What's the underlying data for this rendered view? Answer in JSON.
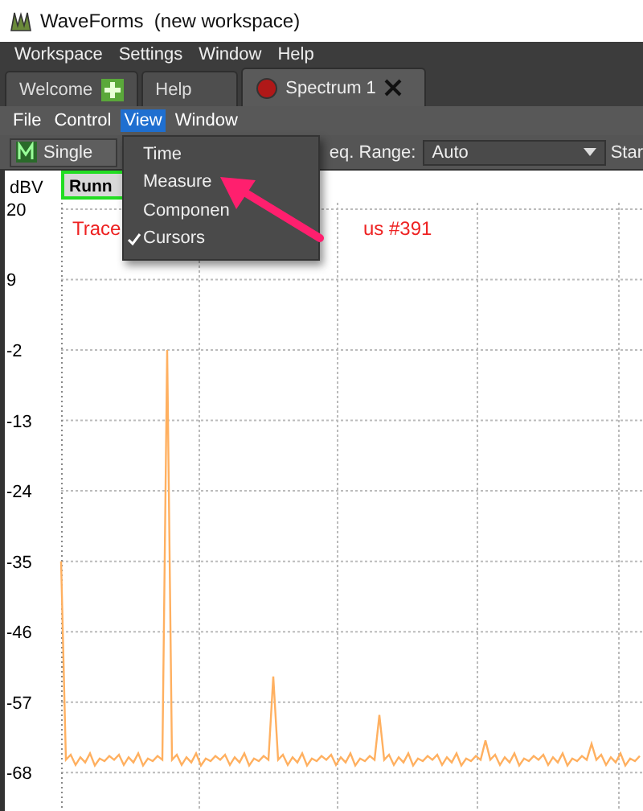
{
  "window": {
    "title": "WaveForms  (new workspace)"
  },
  "menu_bar": [
    "Workspace",
    "Settings",
    "Window",
    "Help"
  ],
  "tabs": [
    {
      "label": "Welcome",
      "kind": "add",
      "selected": false
    },
    {
      "label": "Help",
      "kind": "plain",
      "selected": false
    },
    {
      "label": "Spectrum 1",
      "kind": "instrument",
      "selected": true
    }
  ],
  "sub_menu": [
    {
      "label": "File",
      "selected": false
    },
    {
      "label": "Control",
      "selected": false
    },
    {
      "label": "View",
      "selected": true
    },
    {
      "label": "Window",
      "selected": false
    }
  ],
  "toolbar": {
    "mode": "Single",
    "range_label": "eq. Range:",
    "range_value": "Auto",
    "cut_label": "Star"
  },
  "plot": {
    "status": "Runn",
    "trace_left": "Trace",
    "trace_right": "us #391",
    "chart_data": {
      "type": "line",
      "ylabel": "dBV",
      "grid": true,
      "ylim": [
        -74,
        21
      ],
      "yticks": [
        20,
        9,
        -2,
        -13,
        -24,
        -35,
        -46,
        -57,
        -68
      ],
      "values": [
        -35,
        -66,
        -65.2,
        -66.8,
        -65.6,
        -66.4,
        -65,
        -66.9,
        -65.8,
        -66.2,
        -65.4,
        -66,
        -65.2,
        -66.8,
        -65.6,
        -66.4,
        -65,
        -66.9,
        -65.8,
        -66.2,
        -65.4,
        -66,
        -2,
        -66,
        -65.2,
        -66.8,
        -65.6,
        -66.4,
        -65,
        -66.9,
        -65.8,
        -66.2,
        -65.4,
        -66,
        -65.2,
        -66.8,
        -65.6,
        -66.4,
        -65,
        -66.9,
        -65.8,
        -66.2,
        -65.4,
        -66,
        -53,
        -66,
        -65.2,
        -66.8,
        -65.6,
        -66.4,
        -65,
        -66.9,
        -65.8,
        -66.2,
        -65.4,
        -66,
        -65.2,
        -66.8,
        -65.6,
        -66.4,
        -65,
        -66.9,
        -65.8,
        -66.2,
        -65.4,
        -66,
        -59,
        -66,
        -65.2,
        -66.8,
        -65.6,
        -66.4,
        -65,
        -66.9,
        -65.8,
        -66.2,
        -65.4,
        -66,
        -65.2,
        -66.8,
        -65.6,
        -66.4,
        -65,
        -66.9,
        -65.8,
        -66.2,
        -65.4,
        -66,
        -63,
        -66,
        -65.2,
        -66.8,
        -65.6,
        -66.4,
        -65,
        -66.9,
        -65.8,
        -66.2,
        -65.4,
        -66,
        -65.2,
        -66.8,
        -65.6,
        -66.4,
        -65,
        -66.9,
        -65.8,
        -66.2,
        -65.4,
        -66,
        -63.5,
        -66,
        -65.2,
        -66.8,
        -65.6,
        -66.4,
        -65,
        -66.9,
        -65.8,
        -66.2,
        -65.4
      ]
    }
  },
  "view_menu": [
    {
      "label": "Time",
      "checked": false
    },
    {
      "label": "Measure",
      "checked": false
    },
    {
      "label": "Componen",
      "checked": false
    },
    {
      "label": "Cursors",
      "checked": true
    }
  ]
}
